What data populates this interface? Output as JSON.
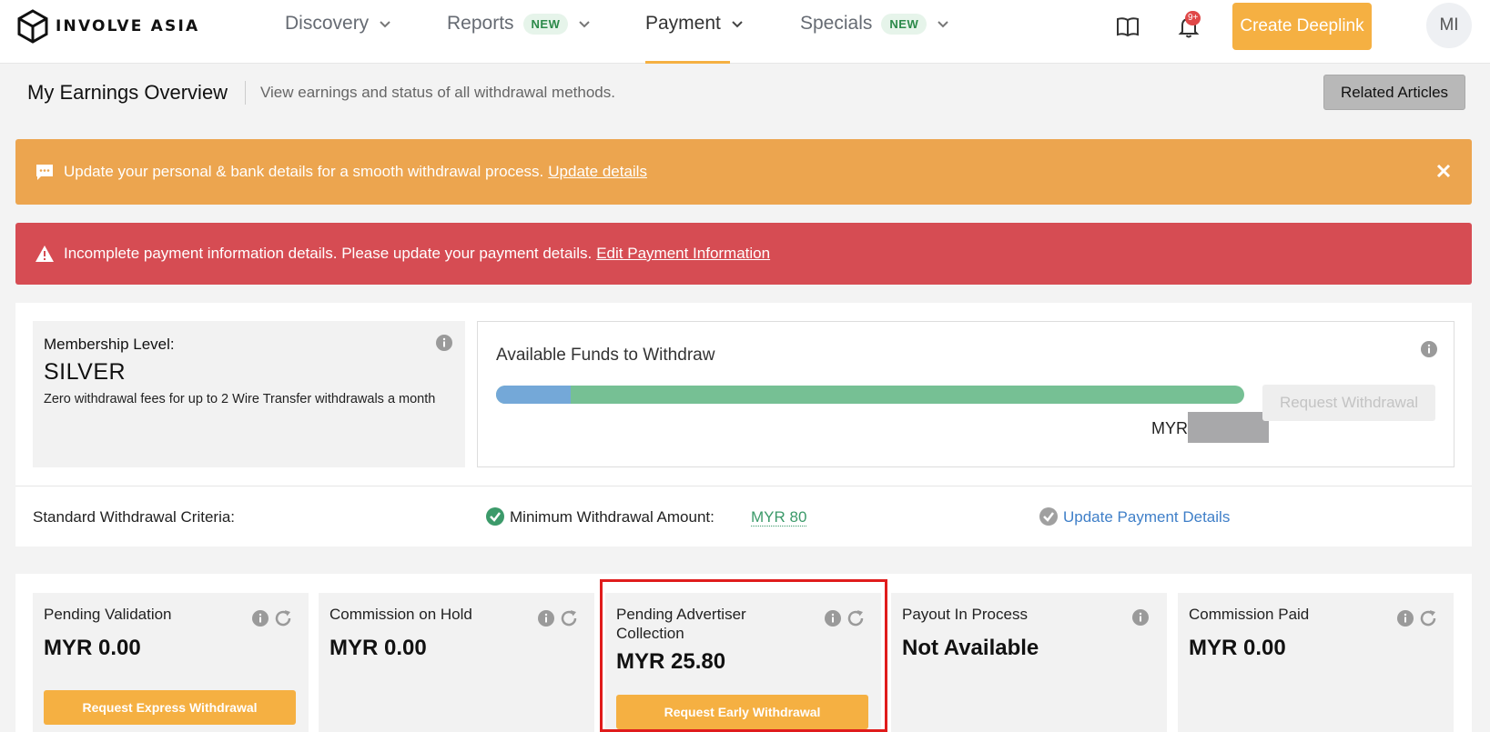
{
  "nav": {
    "logo_text": "INVOLVE ASIA",
    "items": [
      {
        "label": "Discovery",
        "badge": ""
      },
      {
        "label": "Reports",
        "badge": "NEW"
      },
      {
        "label": "Payment",
        "badge": ""
      },
      {
        "label": "Specials",
        "badge": "NEW"
      }
    ],
    "active_item": "Payment",
    "notification_count": "9+",
    "create_button": "Create Deeplink",
    "avatar_initials": "MI"
  },
  "header": {
    "title": "My Earnings Overview",
    "subtitle": "View earnings and status of all withdrawal methods.",
    "related_button": "Related Articles"
  },
  "alerts": {
    "info": {
      "text": "Update your personal & bank details for a smooth withdrawal process.",
      "link": "Update details"
    },
    "error": {
      "text": "Incomplete payment information details. Please update your payment details.",
      "link": "Edit Payment Information"
    }
  },
  "membership": {
    "label": "Membership Level:",
    "level": "SILVER",
    "description": "Zero withdrawal fees for up to 2 Wire Transfer withdrawals a month"
  },
  "funds": {
    "title": "Available Funds to Withdraw",
    "progress_fraction": 0.1,
    "currency": "MYR",
    "button": "Request Withdrawal"
  },
  "criteria": {
    "label": "Standard Withdrawal Criteria:",
    "min_label": "Minimum Withdrawal Amount:",
    "min_value": "MYR 80",
    "update_link": "Update Payment Details"
  },
  "cards": [
    {
      "title": "Pending Validation",
      "amount": "MYR 0.00",
      "button": "Request Express Withdrawal"
    },
    {
      "title": "Commission on Hold",
      "amount": "MYR 0.00",
      "button": ""
    },
    {
      "title": "Pending Advertiser Collection",
      "amount": "MYR 25.80",
      "button": "Request Early Withdrawal"
    },
    {
      "title": "Payout In Process",
      "amount": "Not Available",
      "button": ""
    },
    {
      "title": "Commission Paid",
      "amount": "MYR 0.00",
      "button": ""
    }
  ],
  "colors": {
    "accent": "#f5b042",
    "info_alert": "#eca54f",
    "error_alert": "#d64c53",
    "success": "#3c9a6a",
    "link": "#3f7fc8",
    "highlight": "#e01c1c"
  }
}
